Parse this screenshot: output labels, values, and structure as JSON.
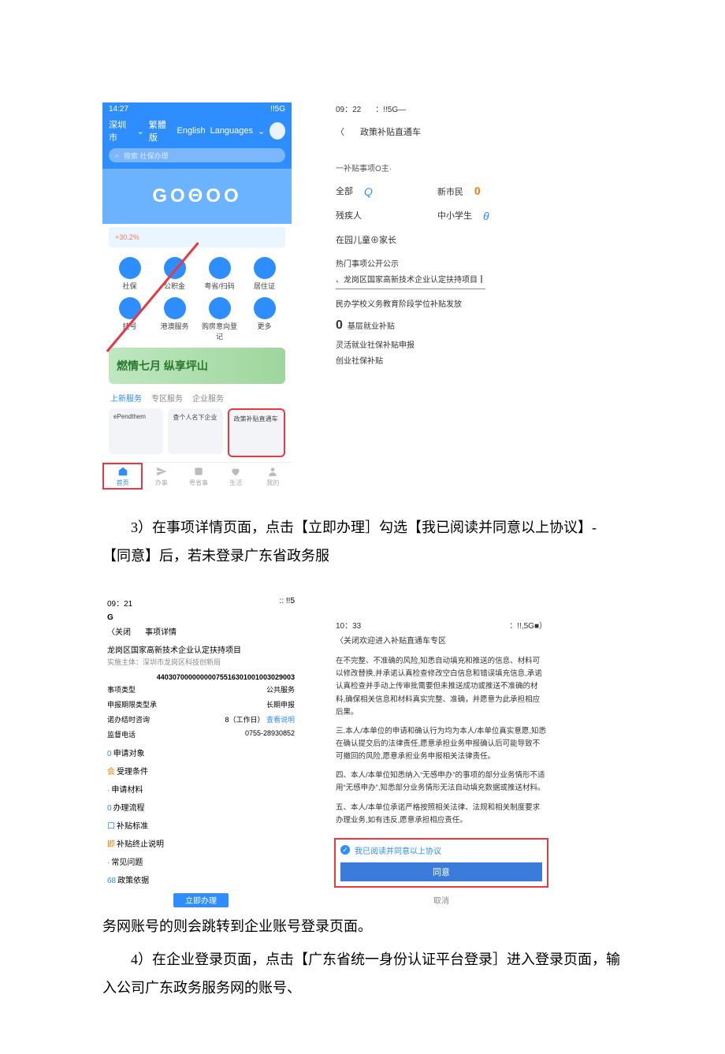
{
  "para3": "3）在事项详情页面，点击【立即办理］勾选【我已阅读并同意以上协议】-【同意】后，若未登录广东省政务服",
  "para_cont": "务网账号的则会跳转到企业账号登录页面。",
  "para4": "4）在企业登录页面，点击【广东省统一身份认证平台登录］进入登录页面，输入公司广东政务服务网的账号、",
  "sA": {
    "status_time": "14:27",
    "status_net": "!!5G",
    "city": "深圳市",
    "tabs": [
      "繁體版",
      "English",
      "Languages"
    ],
    "search_ph": "搜索 社保办理",
    "banner": "GOΘOO",
    "promo": "+30.2%",
    "grid": [
      "社保",
      "公积金",
      "粤省/扫码",
      "居住证",
      "挂号",
      "港澳服务",
      "购房意向登记",
      "更多"
    ],
    "banner2": "燃情七月  纵享坪山",
    "tabs2": [
      "上新服务",
      "专区服务",
      "企业服务"
    ],
    "cards": [
      "ePendthem",
      "查个人名下企业",
      "政策补贴直通车"
    ],
    "nav": [
      "首页",
      "办事",
      "粤省事",
      "生活",
      "我的"
    ]
  },
  "sB": {
    "status_time": "09：22",
    "status_net": "：!!5G—",
    "back": "〈",
    "title": "政策补贴直通车",
    "sub": "一补贴事项O主·",
    "cats": [
      {
        "label": "全部",
        "glyph": "Q",
        "cls": "glyph"
      },
      {
        "label": "新市民",
        "glyph": "0",
        "cls": "glyphO"
      },
      {
        "label": "残疾人",
        "glyph": "",
        "cls": ""
      },
      {
        "label": "中小学生",
        "glyph": "θ",
        "cls": "glyph"
      },
      {
        "label": "在园儿童⊕家长",
        "glyph": "",
        "cls": ""
      }
    ],
    "hot_header": "热门事项公开公示",
    "hot": "、龙岗区国家高新技术企业认定扶持项目┃",
    "list": [
      "民办学校义务教育阶段学位补贴发放",
      "基层就业补贴",
      "灵活就业社保补贴申报",
      "创业社保补贴"
    ]
  },
  "sC": {
    "status_time": "09：21",
    "status_net": ":: !!5",
    "g": "G",
    "close": "〈关闭",
    "title": "事项详情",
    "item": "龙岗区国家高新技术企业认定扶持项目",
    "host": "实施主体：深圳市龙岗区科技创新局",
    "code1": "44030700000000075516301001003029003",
    "code2": "",
    "kv": [
      {
        "k": "事项类型",
        "v": "公共服务"
      },
      {
        "k": "申报期限类型承",
        "v": "长期申报"
      },
      {
        "k": "诺办结时咨询",
        "v": "8（工作日）",
        "blue": "查看说明"
      },
      {
        "k": "监督电话",
        "v": "0755-28930852"
      }
    ],
    "sections": [
      {
        "pre": "0",
        "cls": "pre",
        "t": "申请对象"
      },
      {
        "pre": "会",
        "cls": "preO",
        "t": "受理条件"
      },
      {
        "pre": "·",
        "cls": "pre",
        "t": "申请材料"
      },
      {
        "pre": "0",
        "cls": "pre",
        "t": "办理流程"
      },
      {
        "pre": "口",
        "cls": "pre",
        "t": "补贴标准"
      },
      {
        "pre": "即",
        "cls": "preO",
        "t": "补贴终止说明"
      },
      {
        "pre": "·",
        "cls": "pre",
        "t": "常见问题"
      },
      {
        "pre": "68",
        "cls": "pre",
        "t": "政策依据"
      }
    ],
    "btn": "立即办理"
  },
  "sD": {
    "status_time": "10：33",
    "status_net": "：!!,5G■）",
    "title": "〈关闭欢迎进入补贴直通车专区",
    "p1": "在不完整、不准确的风险,知悉自动填充和推送的信息、材料可以修改替换,并承诺认真检查修改空白信息和错误填充信息,承诺认真检查并手动上传审批需要但未推送成功或推送不准确的材料,确保相关信息和材料真实完整、准确，并愿意为此承担相应后果。",
    "p2": "三.本人/本单位的申请和确认行为均为本人/本单位真实意愿,知悉在确认提交后的法律责任,愿意承担业务申报确认后可能导致不可撤回的风险,愿意承担业务申报相关法律责任。",
    "p3": "四、本人/本单位知悉纳入“无感申办”的事项的部分业务情形不适用“无感申办”,知悉部分业务情形无法自动填充数据或推送材料。",
    "p4": "五、本人/本单位承诺严格按照相关法律、法规和相关制度要求办理业务,如有违反,愿意承担相应责任。",
    "check": "我已阅读并同意以上协议",
    "ok": "同意",
    "cancel": "取消"
  }
}
